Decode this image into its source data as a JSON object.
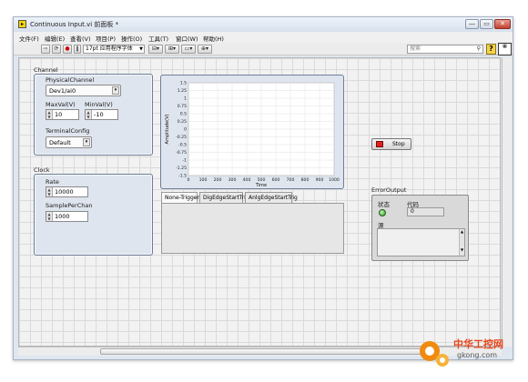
{
  "window": {
    "title": "Continuous Input.vi 前面板 *",
    "controls": [
      "—",
      "▭",
      "✕"
    ]
  },
  "menu": [
    "文件(F)",
    "编辑(E)",
    "查看(V)",
    "项目(P)",
    "操作(O)",
    "工具(T)",
    "窗口(W)",
    "帮助(H)"
  ],
  "toolbar": {
    "font_select": "17pt 应用程序字体",
    "search_placeholder": "搜索",
    "help_label": "?"
  },
  "channel": {
    "group_label": "Channel",
    "physical_channel_label": "PhysicalChannel",
    "physical_channel_value": "Dev1/ai0",
    "maxval_label": "MaxVal(V)",
    "maxval_value": "10",
    "minval_label": "MinVal(V)",
    "minval_value": "-10",
    "terminal_label": "TerminalConfig",
    "terminal_value": "Default"
  },
  "clock": {
    "group_label": "Clock",
    "rate_label": "Rate",
    "rate_value": "10000",
    "samples_label": "SamplePerChan",
    "samples_value": "1000"
  },
  "chart_data": {
    "type": "line",
    "title": "",
    "xlabel": "Time",
    "ylabel": "Amplitude(V)",
    "xlim": [
      0,
      1000
    ],
    "ylim": [
      -1.5,
      1.5
    ],
    "xticks": [
      "0",
      "100",
      "200",
      "300",
      "400",
      "500",
      "600",
      "700",
      "800",
      "900",
      "1000"
    ],
    "yticks": [
      "1.5",
      "1.25",
      "1",
      "0.75",
      "0.5",
      "0.25",
      "0",
      "-0.25",
      "-0.5",
      "-0.75",
      "-1",
      "-1.25",
      "-1.5"
    ],
    "grid": true,
    "series": []
  },
  "trigger_tabs": [
    "None-Trigger",
    "DigEdgeStartTrig",
    "AnlgEdgeStartTrig"
  ],
  "stop_button": "Stop",
  "error_output": {
    "label": "ErrorOutput",
    "status_label": "状态",
    "code_label": "代码",
    "code_value": "0",
    "source_label": "源"
  },
  "watermark": {
    "text": "中华工控网",
    "url": "gkong.com"
  },
  "colors": {
    "stop_led": "#e02020",
    "status_led": "#2f9d22",
    "watermark_orange": "#f08a10"
  }
}
